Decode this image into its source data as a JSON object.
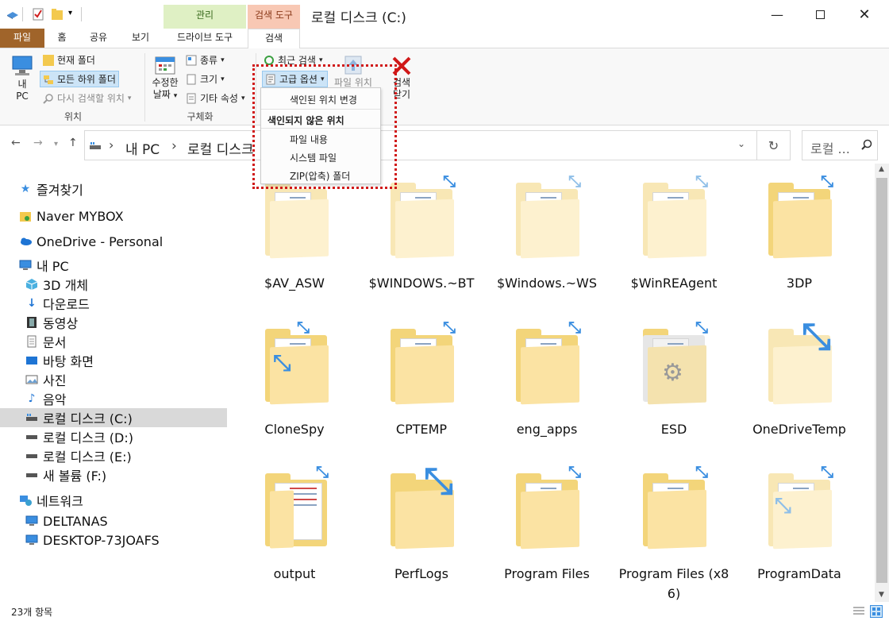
{
  "window": {
    "title": "로컬 디스크 (C:)"
  },
  "context_tabs": {
    "manage": "관리",
    "search_tools": "검색 도구"
  },
  "ribbon_tabs": {
    "file": "파일",
    "home": "홈",
    "share": "공유",
    "view": "보기",
    "drive_tools": "드라이브 도구",
    "search": "검색"
  },
  "ribbon": {
    "location": {
      "label": "위치",
      "this_pc": [
        "내",
        "PC"
      ],
      "current_folder": "현재 폴더",
      "all_subfolders": "모든 하위 폴더",
      "search_again": "다시 검색할 위치"
    },
    "refine": {
      "label": "구체화",
      "date_modified": [
        "수정한",
        "날짜"
      ],
      "kind": "종류",
      "size": "크기",
      "other_props": "기타 속성"
    },
    "options": {
      "recent_searches": "최근 검색",
      "advanced_options": "고급 옵션",
      "open_file_location": "파일 위치",
      "close_search": [
        "검색",
        "닫기"
      ]
    }
  },
  "dropdown": {
    "change_indexed": "색인된 위치 변경",
    "header": "색인되지 않은 위치",
    "file_contents": "파일 내용",
    "system_files": "시스템 파일",
    "zip_folders": "ZIP(압축) 폴더"
  },
  "address": {
    "crumbs": [
      "내 PC",
      "로컬 디스크"
    ],
    "search_placeholder": "로컬 ..."
  },
  "nav": {
    "quick_access": "즐겨찾기",
    "mybox": "Naver MYBOX",
    "onedrive": "OneDrive - Personal",
    "this_pc": "내 PC",
    "objects3d": "3D 개체",
    "downloads": "다운로드",
    "videos": "동영상",
    "documents": "문서",
    "desktop": "바탕 화면",
    "pictures": "사진",
    "music": "음악",
    "drive_c": "로컬 디스크 (C:)",
    "drive_d": "로컬 디스크 (D:)",
    "drive_e": "로컬 디스크 (E:)",
    "drive_f": "새 볼륨 (F:)",
    "network": "네트워크",
    "deltanas": "DELTANAS",
    "desktop_pc": "DESKTOP-73JOAFS"
  },
  "folders": [
    {
      "name": "$AV_ASW"
    },
    {
      "name": "$WINDOWS.~BT"
    },
    {
      "name": "$Windows.~WS"
    },
    {
      "name": "$WinREAgent"
    },
    {
      "name": "3DP"
    },
    {
      "name": "CloneSpy"
    },
    {
      "name": "CPTEMP"
    },
    {
      "name": "eng_apps"
    },
    {
      "name": "ESD"
    },
    {
      "name": "OneDriveTemp"
    },
    {
      "name": "output"
    },
    {
      "name": "PerfLogs"
    },
    {
      "name": "Program Files"
    },
    {
      "name": "Program Files (x86)"
    },
    {
      "name": "ProgramData"
    }
  ],
  "status": {
    "count": "23개 항목"
  },
  "colors": {
    "accent": "#a0642a",
    "highlight": "#d01818",
    "folder": "#f3d57a",
    "selection": "#cce4f7"
  }
}
